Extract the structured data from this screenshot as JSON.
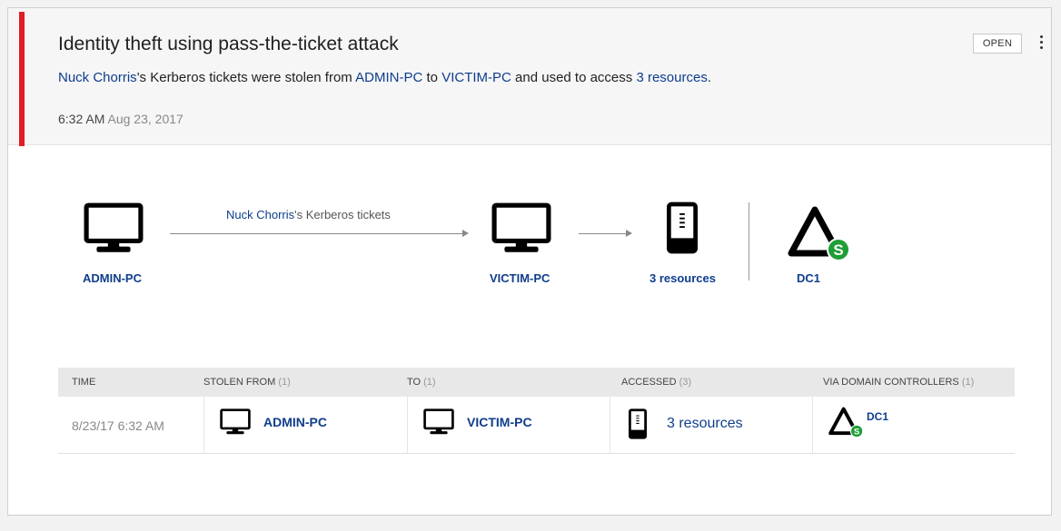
{
  "alert": {
    "title": "Identity theft using pass-the-ticket attack",
    "description": {
      "user": "Nuck Chorris",
      "text1": "'s Kerberos tickets were stolen from ",
      "source": "ADMIN-PC",
      "text2": " to ",
      "target": "VICTIM-PC",
      "text3": " and used to access ",
      "resources": "3 resources",
      "text4": "."
    },
    "time": "6:32 AM",
    "date": "Aug 23, 2017",
    "status": "OPEN",
    "severity_color": "#e01c24"
  },
  "graph": {
    "edge_label_user": "Nuck Chorris",
    "edge_label_suffix": "'s Kerberos tickets",
    "nodes": {
      "source": "ADMIN-PC",
      "target": "VICTIM-PC",
      "resources": "3 resources",
      "dc": "DC1"
    }
  },
  "table": {
    "headers": [
      {
        "label": "TIME",
        "count": ""
      },
      {
        "label": "STOLEN FROM",
        "count": "(1)"
      },
      {
        "label": "TO",
        "count": "(1)"
      },
      {
        "label": "ACCESSED",
        "count": "(3)"
      },
      {
        "label": "VIA DOMAIN CONTROLLERS",
        "count": "(1)"
      }
    ],
    "row": {
      "time": "8/23/17 6:32 AM",
      "stolen_from": "ADMIN-PC",
      "to": "VICTIM-PC",
      "accessed": "3 resources",
      "via_dc": "DC1"
    }
  },
  "icons": {
    "computer": "monitor-icon",
    "resource": "server-icon",
    "domain_controller": "domain-controller-icon",
    "dc_badge_letter": "S",
    "dc_badge_color": "#1e9e36"
  }
}
